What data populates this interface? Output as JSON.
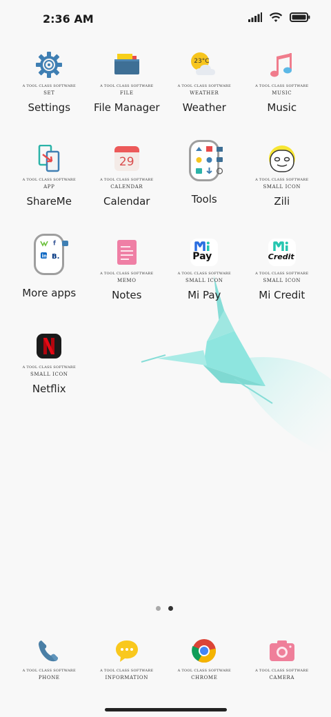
{
  "status_bar": {
    "time": "2:36 AM"
  },
  "apps": [
    {
      "name": "Settings",
      "caption": "A TOOL CLASS SOFTWARE",
      "category": "SET",
      "icon": "settings-gear-icon"
    },
    {
      "name": "File Manager",
      "caption": "A TOOL CLASS SOFTWARE",
      "category": "FILE",
      "icon": "folder-icon"
    },
    {
      "name": "Weather",
      "caption": "A TOOL CLASS SOFTWARE",
      "category": "WEATHER",
      "icon": "weather-icon",
      "temperature": "23°C"
    },
    {
      "name": "Music",
      "caption": "A TOOL CLASS SOFTWARE",
      "category": "MUSIC",
      "icon": "music-note-icon"
    },
    {
      "name": "ShareMe",
      "caption": "A TOOL CLASS SOFTWARE",
      "category": "APP",
      "icon": "share-phones-icon"
    },
    {
      "name": "Calendar",
      "caption": "A TOOL CLASS SOFTWARE",
      "category": "CALENDAR",
      "icon": "calendar-icon",
      "day": "29"
    },
    {
      "name": "Tools",
      "icon": "tools-folder-icon"
    },
    {
      "name": "Zili",
      "caption": "A TOOL CLASS SOFTWARE",
      "category": "SMALL ICON",
      "icon": "zili-face-icon"
    },
    {
      "name": "More apps",
      "icon": "more-apps-folder-icon"
    },
    {
      "name": "Notes",
      "caption": "A TOOL CLASS SOFTWARE",
      "category": "MEMO",
      "icon": "notes-icon"
    },
    {
      "name": "Mi Pay",
      "caption": "A TOOL CLASS SOFTWARE",
      "category": "SMALL ICON",
      "icon": "mi-pay-icon",
      "logo_text": "Pay"
    },
    {
      "name": "Mi Credit",
      "caption": "A TOOL CLASS SOFTWARE",
      "category": "SMALL ICON",
      "icon": "mi-credit-icon",
      "logo_text": "Credit"
    },
    {
      "name": "Netflix",
      "caption": "A TOOL CLASS SOFTWARE",
      "category": "SMALL ICON",
      "icon": "netflix-icon"
    }
  ],
  "dock": [
    {
      "caption": "A TOOL CLASS SOFTWARE",
      "category": "PHONE",
      "icon": "phone-icon"
    },
    {
      "caption": "A TOOL CLASS SOFTWARE",
      "category": "INFORMATION",
      "icon": "message-bubble-icon"
    },
    {
      "caption": "A TOOL CLASS SOFTWARE",
      "category": "CHROME",
      "icon": "chrome-icon"
    },
    {
      "caption": "A TOOL CLASS SOFTWARE",
      "category": "CAMERA",
      "icon": "camera-icon"
    }
  ],
  "pager": {
    "pages": 2,
    "current": 2
  },
  "colors": {
    "background": "#f8f8f8",
    "settings": "#3f7fb3",
    "netflix_red": "#e50914",
    "mi_teal": "#26c6b0",
    "origami_mint": "#8ee5df"
  }
}
